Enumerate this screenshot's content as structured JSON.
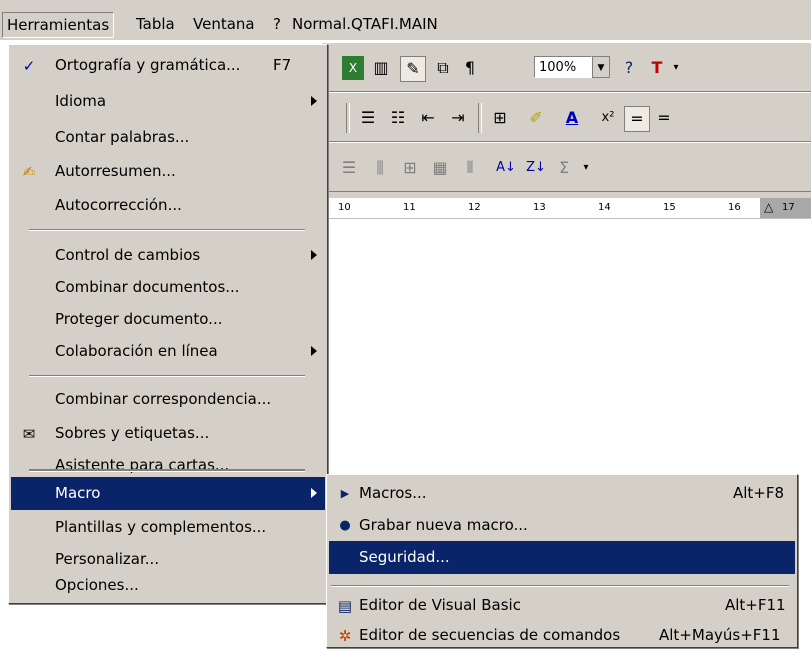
{
  "menubar": {
    "items": [
      "Herramientas",
      "Tabla",
      "Ventana",
      "?",
      "Normal.QTAFI.MAIN"
    ]
  },
  "toolbar": {
    "zoom": "100%",
    "pilcrow": "¶",
    "sigma": "Σ",
    "superscript": "x²"
  },
  "ruler": {
    "ticks": [
      "10",
      "11",
      "12",
      "13",
      "14",
      "15",
      "16",
      "17"
    ]
  },
  "tools_menu": {
    "items": [
      {
        "label": "Ortografía y gramática...",
        "shortcut": "F7",
        "icon": "spellcheck-icon"
      },
      {
        "label": "Idioma",
        "submenu": true
      },
      {
        "label": "Contar palabras..."
      },
      {
        "label": "Autorresumen...",
        "icon": "autosummary-icon"
      },
      {
        "label": "Autocorrección..."
      },
      {
        "label": "Control de cambios",
        "submenu": true
      },
      {
        "label": "Combinar documentos..."
      },
      {
        "label": "Proteger documento..."
      },
      {
        "label": "Colaboración en línea",
        "submenu": true
      },
      {
        "label": "Combinar correspondencia..."
      },
      {
        "label": "Sobres y etiquetas...",
        "icon": "envelope-icon"
      },
      {
        "label": "Asistente para cartas..."
      },
      {
        "label": "Macro",
        "submenu": true,
        "highlighted": true
      },
      {
        "label": "Plantillas y complementos..."
      },
      {
        "label": "Personalizar..."
      },
      {
        "label": "Opciones..."
      }
    ]
  },
  "macro_menu": {
    "items": [
      {
        "label": "Macros...",
        "shortcut": "Alt+F8",
        "icon": "play-icon"
      },
      {
        "label": "Grabar nueva macro...",
        "icon": "record-icon"
      },
      {
        "label": "Seguridad...",
        "highlighted": true
      },
      {
        "label": "Editor de Visual Basic",
        "shortcut": "Alt+F11",
        "icon": "vb-editor-icon"
      },
      {
        "label": "Editor de secuencias de comandos",
        "shortcut": "Alt+Mayús+F11",
        "icon": "script-editor-icon"
      }
    ]
  },
  "colors": {
    "menu_bg": "#d4d0c8",
    "highlight": "#0a246a"
  }
}
